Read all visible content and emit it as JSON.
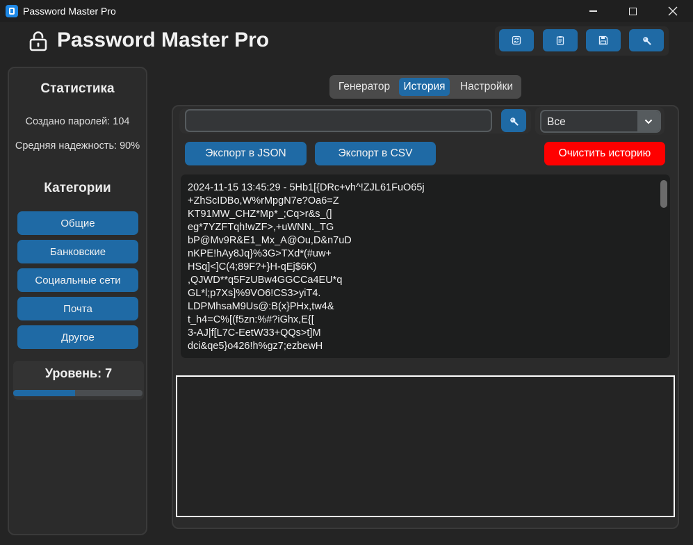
{
  "window": {
    "title": "Password Master Pro",
    "minimize_symbol": "—",
    "maximize_symbol": "□",
    "close_symbol": "✕"
  },
  "header": {
    "title": "Password Master Pro",
    "toolbar_icons": [
      "refresh-icon",
      "clipboard-icon",
      "save-icon",
      "search-icon"
    ]
  },
  "sidebar": {
    "stats_heading": "Статистика",
    "created_passwords": "Создано паролей: 104",
    "average_strength": "Средняя надежность: 90%",
    "categories_heading": "Категории",
    "categories": [
      {
        "label": "Общие"
      },
      {
        "label": "Банковские"
      },
      {
        "label": "Социальные сети"
      },
      {
        "label": "Почта"
      },
      {
        "label": "Другое"
      }
    ],
    "level_label": "Уровень: 7",
    "level_progress": 0.48
  },
  "tabs": [
    {
      "label": "Генератор",
      "active": false
    },
    {
      "label": "История",
      "active": true
    },
    {
      "label": "Настройки",
      "active": false
    }
  ],
  "history": {
    "search_value": "",
    "filter_value": "Все",
    "export_json_label": "Экспорт в JSON",
    "export_csv_label": "Экспорт в CSV",
    "clear_label": "Очистить историю",
    "entry_lines": [
      "2024-11-15 13:45:29 - 5Hb1[{DRc+vh^!ZJL61FuO65j",
      "+ZhScIDBo,W%rMpgN7e?Oa6=Z",
      "KT91MW_CHZ*Mp*_;Cq>r&s_(]",
      "eg*7YZFTqh!wZF>,+uWNN._TG",
      "bP@Mv9R&E1_Mx_A@Ou,D&n7uD",
      "nKPE!hAy8Jq}%3G>TXd*(#uw+",
      "HSq]<]C(4;89F?+}H-qEj$6K)",
      ",QJWD**q5FzUBw4GGCCa4EU*q",
      "GL*l;p7Xs]%9VO6!CS3>yiT4.",
      "LDPMhsaM9Us@:B(x}PHx,tw4&",
      "t_h4=C%[(f5zn:%#?iGhx,E{[",
      "3-AJ|f[L7C-EetW33+QQs>t]M",
      "dci&qe5}o426!h%gz7;ezbewH"
    ]
  },
  "colors": {
    "accent": "#1f6aa5",
    "danger": "#ff0000",
    "background": "#242424",
    "panel": "#2b2b2b"
  }
}
